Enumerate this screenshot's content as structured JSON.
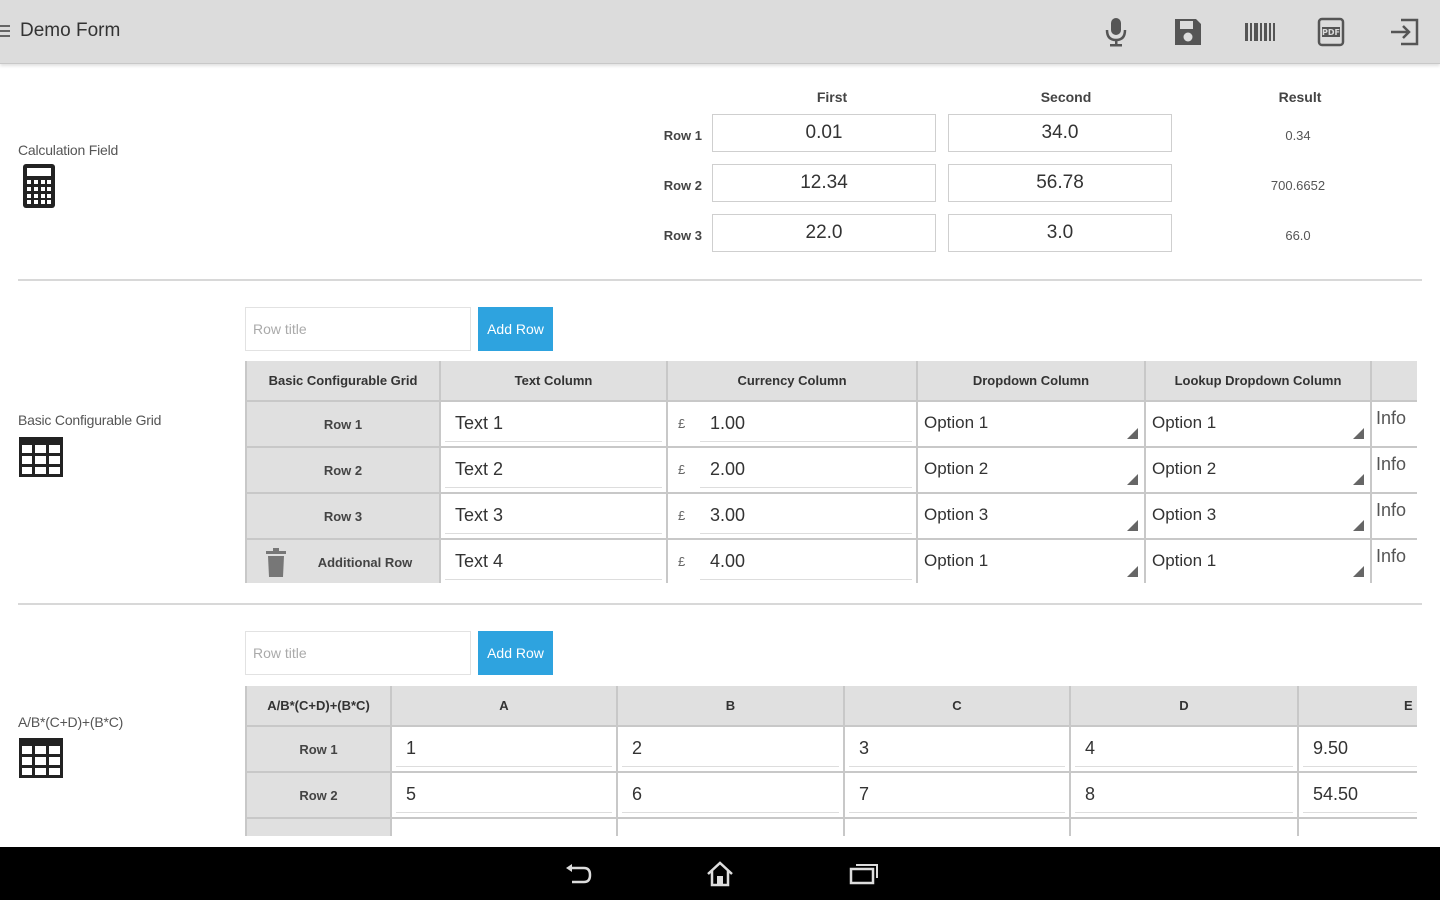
{
  "app": {
    "title": "Demo Form"
  },
  "toolbar": {
    "icons": [
      "microphone-icon",
      "save-icon",
      "barcode-icon",
      "pdf-icon",
      "exit-icon"
    ]
  },
  "calculation": {
    "label": "Calculation Field",
    "columns": [
      "First",
      "Second",
      "Result"
    ],
    "rows": [
      {
        "label": "Row 1",
        "first": "0.01",
        "second": "34.0",
        "result": "0.34"
      },
      {
        "label": "Row 2",
        "first": "12.34",
        "second": "56.78",
        "result": "700.6652"
      },
      {
        "label": "Row 3",
        "first": "22.0",
        "second": "3.0",
        "result": "66.0"
      }
    ]
  },
  "basic_grid": {
    "label": "Basic Configurable Grid",
    "row_title_placeholder": "Row title",
    "add_row_label": "Add Row",
    "headers": [
      "Basic Configurable Grid",
      "Text Column",
      "Currency Column",
      "Dropdown Column",
      "Lookup Dropdown Column",
      ""
    ],
    "currency_symbol": "£",
    "rows": [
      {
        "label": "Row 1",
        "text": "Text 1",
        "currency": "1.00",
        "dropdown": "Option 1",
        "lookup": "Option 1",
        "info": "Info"
      },
      {
        "label": "Row 2",
        "text": "Text 2",
        "currency": "2.00",
        "dropdown": "Option 2",
        "lookup": "Option 2",
        "info": "Info"
      },
      {
        "label": "Row 3",
        "text": "Text 3",
        "currency": "3.00",
        "dropdown": "Option 3",
        "lookup": "Option 3",
        "info": "Info"
      },
      {
        "label": "Additional Row",
        "text": "Text 4",
        "currency": "4.00",
        "dropdown": "Option 1",
        "lookup": "Option 1",
        "info": "Info"
      }
    ]
  },
  "formula_grid": {
    "label": "A/B*(C+D)+(B*C)",
    "row_title_placeholder": "Row title",
    "add_row_label": "Add Row",
    "headers": [
      "A/B*(C+D)+(B*C)",
      "A",
      "B",
      "C",
      "D",
      "E"
    ],
    "rows": [
      {
        "label": "Row 1",
        "values": [
          "1",
          "2",
          "3",
          "4",
          "9.50"
        ]
      },
      {
        "label": "Row 2",
        "values": [
          "5",
          "6",
          "7",
          "8",
          "54.50"
        ]
      }
    ]
  },
  "navbar": {
    "icons": [
      "back-icon",
      "home-icon",
      "recents-icon"
    ]
  },
  "colors": {
    "accent": "#2ea3df",
    "actionbar": "#dcdcdc",
    "navbar": "#000000"
  }
}
